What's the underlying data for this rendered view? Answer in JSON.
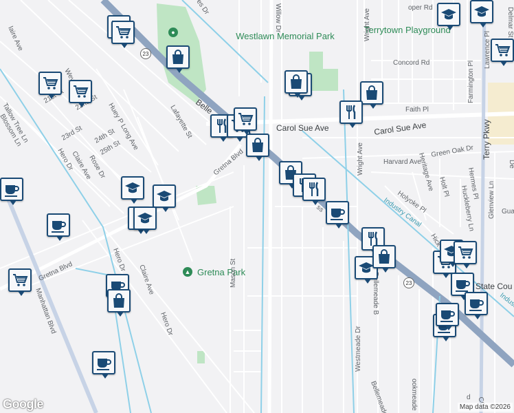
{
  "map": {
    "attribution": "Map data ©2026",
    "logo": "Google",
    "route_shield": "23",
    "parks": [
      "Westlawn Memorial Park",
      "Terrytown Playground",
      "Gretna Park"
    ],
    "waterways": [
      "Industry Canal",
      "Industry"
    ],
    "streets": {
      "carol_sue": "Carol Sue Ave",
      "carol_sue_2": "Carol Sue Ave",
      "gretna_blvd": "Gretna Blvd",
      "gretna_blvd_2": "Gretna Blvd",
      "belle": "Belle",
      "willow": "Willow Dr",
      "wright": "Wright Ave",
      "wright_2": "Wright Ave",
      "concord": "Concord Rd",
      "faith": "Faith Pl",
      "harvard": "Harvard Ave",
      "green_oak": "Green Oak Dr",
      "heritage": "Heritage Ave",
      "holyoke": "Holyoke Pl",
      "holt": "Holt Pl",
      "hermes": "Hermes Pl",
      "huckleberry": "Huckleberry Ln",
      "glenview": "Glenview Ln",
      "terry": "Terry Pkwy",
      "farmington": "Farmington Pl",
      "lawrence": "Lawrence Pl",
      "delmar": "Delmar St",
      "cooper": "oper Rd",
      "lafayette": "Lafayette St",
      "huey": "Huey P Long Ave",
      "hero1": "Hero Dr",
      "hero2": "Hero Dr",
      "hero3": "Hero Dr",
      "claire1": "Claire Ave",
      "claire2": "Claire Ave",
      "rose": "Rose Dr",
      "st21": "21st St",
      "st22": "22nd St",
      "st23": "23rd St",
      "st24": "24th St",
      "st25": "25th St",
      "tallow": "Tallow Tree Ln",
      "blossom": "Blossom Ln",
      "manhattan": "Manhattan Blvd",
      "mason": "Mason St",
      "westmeade": "Westmeade Dr",
      "bellemeade": "Bellemeade B",
      "bellemeade2": "Bellemeade Dr",
      "brookmeade": "ookmeade Dr",
      "claire_top": "laire Ave",
      "weye": "Weye",
      "hick": "Hick",
      "gua": "Gua",
      "state_cou": "State Cou",
      "es_dr": "es Dr",
      "co": "Co",
      "de": "De",
      "d": "d",
      "ss": "ss"
    },
    "pins": [
      {
        "type": "cart",
        "icon": "shopping-cart-icon"
      },
      {
        "type": "cart",
        "icon": "shopping-cart-icon"
      },
      {
        "type": "bag",
        "icon": "shopping-bag-icon"
      },
      {
        "type": "cart",
        "icon": "shopping-cart-icon"
      },
      {
        "type": "cart",
        "icon": "shopping-cart-icon"
      },
      {
        "type": "bag",
        "icon": "shopping-bag-icon"
      },
      {
        "type": "bag",
        "icon": "shopping-bag-icon"
      },
      {
        "type": "bag",
        "icon": "shopping-bag-icon"
      },
      {
        "type": "fork",
        "icon": "restaurant-icon"
      },
      {
        "type": "edu",
        "icon": "school-icon"
      },
      {
        "type": "edu",
        "icon": "school-icon"
      },
      {
        "type": "cart",
        "icon": "shopping-cart-icon"
      },
      {
        "type": "fork",
        "icon": "restaurant-icon"
      },
      {
        "type": "cart",
        "icon": "shopping-cart-icon"
      },
      {
        "type": "bag",
        "icon": "shopping-bag-icon"
      },
      {
        "type": "bag",
        "icon": "shopping-bag-icon"
      },
      {
        "type": "fork",
        "icon": "restaurant-icon"
      },
      {
        "type": "fork",
        "icon": "restaurant-icon"
      },
      {
        "type": "cafe",
        "icon": "cafe-icon"
      },
      {
        "type": "bag",
        "icon": "shopping-bag-icon"
      },
      {
        "type": "edu",
        "icon": "school-icon"
      },
      {
        "type": "edu",
        "icon": "school-icon"
      },
      {
        "type": "cafe",
        "icon": "cafe-icon"
      },
      {
        "type": "cafe",
        "icon": "cafe-icon"
      },
      {
        "type": "cart",
        "icon": "shopping-cart-icon"
      },
      {
        "type": "cafe",
        "icon": "cafe-icon"
      },
      {
        "type": "bag",
        "icon": "shopping-bag-icon"
      },
      {
        "type": "cafe",
        "icon": "cafe-icon"
      },
      {
        "type": "fork",
        "icon": "restaurant-icon"
      },
      {
        "type": "cart",
        "icon": "shopping-cart-icon"
      },
      {
        "type": "bag",
        "icon": "shopping-bag-icon"
      },
      {
        "type": "edu",
        "icon": "school-icon"
      },
      {
        "type": "cart",
        "icon": "shopping-cart-icon"
      },
      {
        "type": "cafe",
        "icon": "cafe-icon"
      },
      {
        "type": "cafe",
        "icon": "cafe-icon"
      },
      {
        "type": "cafe",
        "icon": "cafe-icon"
      },
      {
        "type": "cafe",
        "icon": "cafe-icon"
      },
      {
        "type": "edu",
        "icon": "school-icon"
      },
      {
        "type": "edu",
        "icon": "school-icon"
      },
      {
        "type": "cart",
        "icon": "shopping-cart-icon"
      }
    ],
    "colors": {
      "pin_border": "#1a4a75",
      "highway": "#8fa4c0",
      "canal": "#8ed0e8",
      "park": "#bfe5c4"
    }
  }
}
